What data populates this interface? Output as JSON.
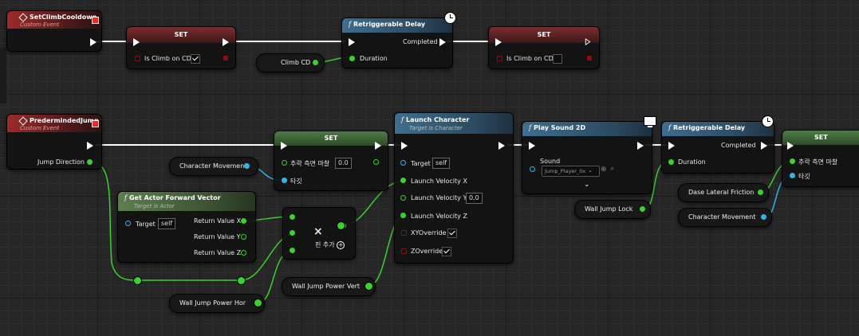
{
  "colors": {
    "exec": "#ffffff",
    "float": "#3bd12f",
    "struct": "#2fb6e6",
    "bool": "#8a0e0e",
    "event_header": "#9e2a2a",
    "function_header": "#3f6e8f",
    "pure_header": "#5d7f4e",
    "set_header_green": "#4f7b45",
    "set_header_red": "#7b2e2e"
  },
  "event_setclimb": {
    "title": "SetClimbCooldown",
    "subtitle": "Custom Event"
  },
  "event_jump": {
    "title": "PredermindedJump",
    "subtitle": "Custom Event",
    "pin_direction": "Jump Direction"
  },
  "set_climb_true": {
    "title": "SET",
    "pin": "Is Climb on CD"
  },
  "set_climb_false": {
    "title": "SET",
    "pin": "Is Climb on CD"
  },
  "delay_top": {
    "title": "Retriggerable Delay",
    "completed": "Completed",
    "duration": "Duration"
  },
  "var_climbcd": {
    "label": "Climb CD"
  },
  "set_move": {
    "title": "SET",
    "pin1": "추락 측면 마찰",
    "pin1_value": "0.0",
    "pin2": "타깃"
  },
  "var_charmove_left": {
    "label": "Character Movement"
  },
  "launch": {
    "title": "Launch Character",
    "subtitle": "Target is Character",
    "target": "Target",
    "target_value": "self",
    "vx": "Launch Velocity X",
    "vy": "Launch Velocity Y",
    "vy_value": "0.0",
    "vz": "Launch Velocity Z",
    "xyo": "XYOverride",
    "zo": "ZOverride"
  },
  "fwd": {
    "title": "Get Actor Forward Vector",
    "subtitle": "Target is Actor",
    "target": "Target",
    "target_value": "self",
    "rx": "Return Value X",
    "ry": "Return Value Y",
    "rz": "Return Value Z"
  },
  "multiply": {
    "symbol": "×",
    "add_pin": "핀 추가"
  },
  "var_wallhor": {
    "label": "Wall Jump Power Hor"
  },
  "var_wallvert": {
    "label": "Wall Jump Power Vert"
  },
  "sound": {
    "title": "Play Sound 2D",
    "pin": "Sound",
    "value": "Jump_Player_0x"
  },
  "var_walllock": {
    "label": "Wall Jump Lock"
  },
  "delay_right": {
    "title": "Retriggerable Delay",
    "completed": "Completed",
    "duration": "Duration"
  },
  "var_dase": {
    "label": "Dase Lateral Friction"
  },
  "var_charmove_right": {
    "label": "Character Movement"
  },
  "set_right": {
    "title": "SET",
    "pin1": "추락 측면 마찰",
    "pin2": "타깃"
  }
}
